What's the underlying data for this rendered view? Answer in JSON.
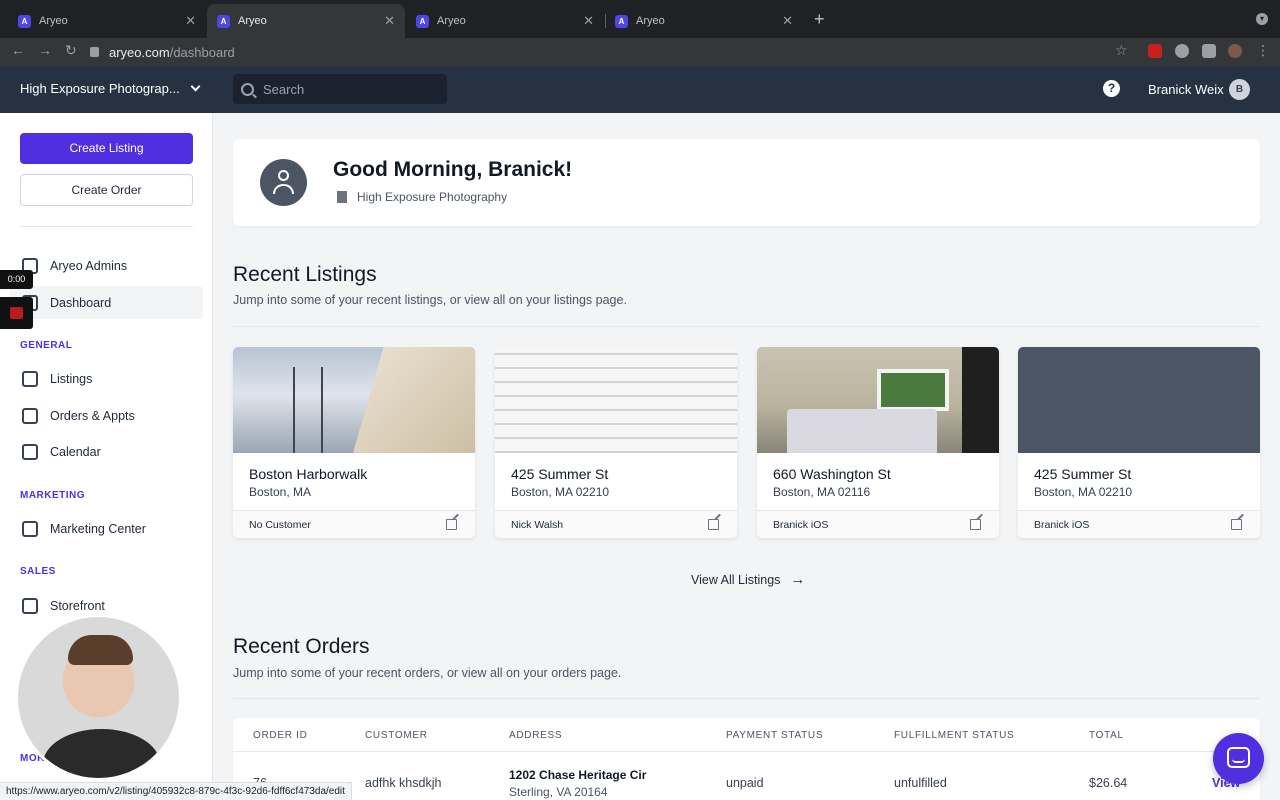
{
  "browser": {
    "tabs": [
      {
        "label": "Aryeo",
        "active": false
      },
      {
        "label": "Aryeo",
        "active": true
      },
      {
        "label": "Aryeo",
        "active": false
      },
      {
        "label": "Aryeo",
        "active": false
      }
    ],
    "url_host": "aryeo.com",
    "url_path": "/dashboard",
    "status_url": "https://www.aryeo.com/v2/listing/405932c8-879c-4f3c-92d6-fdff6cf473da/edit"
  },
  "header": {
    "org_name": "High Exposure Photograp...",
    "search_placeholder": "Search",
    "help_label": "?",
    "user_name": "Branick Weix",
    "user_initial": "B"
  },
  "sidebar": {
    "create_listing": "Create Listing",
    "create_order": "Create Order",
    "items_top": [
      {
        "label": "Aryeo Admins",
        "icon": "admin-icon"
      },
      {
        "label": "Dashboard",
        "icon": "dashboard-icon",
        "active": true
      }
    ],
    "general_label": "GENERAL",
    "general_items": [
      {
        "label": "Listings",
        "icon": "home-icon"
      },
      {
        "label": "Orders & Appts",
        "icon": "clipboard-icon"
      },
      {
        "label": "Calendar",
        "icon": "calendar-icon"
      }
    ],
    "marketing_label": "MARKETING",
    "marketing_items": [
      {
        "label": "Marketing Center",
        "icon": "image-icon"
      }
    ],
    "sales_label": "SALES",
    "sales_items": [
      {
        "label": "Storefront",
        "icon": "bag-icon"
      }
    ],
    "more_label": "MOR"
  },
  "recording": {
    "time": "0:00"
  },
  "greeting": {
    "title": "Good Morning, Branick!",
    "org": "High Exposure Photography"
  },
  "recent_listings": {
    "title": "Recent Listings",
    "subtitle": "Jump into some of your recent listings, or view all on your listings page.",
    "cards": [
      {
        "name": "Boston Harborwalk",
        "city": "Boston, MA",
        "customer": "No Customer"
      },
      {
        "name": "425 Summer St",
        "city": "Boston, MA 02210",
        "customer": "Nick Walsh"
      },
      {
        "name": "660 Washington St",
        "city": "Boston, MA 02116",
        "customer": "Branick iOS"
      },
      {
        "name": "425 Summer St",
        "city": "Boston, MA 02210",
        "customer": "Branick iOS"
      }
    ],
    "view_all": "View All Listings"
  },
  "recent_orders": {
    "title": "Recent Orders",
    "subtitle": "Jump into some of your recent orders, or view all on your orders page.",
    "columns": [
      "ORDER ID",
      "CUSTOMER",
      "ADDRESS",
      "PAYMENT STATUS",
      "FULFILLMENT STATUS",
      "TOTAL"
    ],
    "rows": [
      {
        "order_id": "76",
        "customer": "adfhk khsdkjh",
        "address_line1": "1202 Chase Heritage Cir",
        "address_line2": "Sterling, VA 20164",
        "payment_status": "unpaid",
        "fulfillment_status": "unfulfilled",
        "total": "$26.64",
        "action": "View"
      }
    ]
  }
}
